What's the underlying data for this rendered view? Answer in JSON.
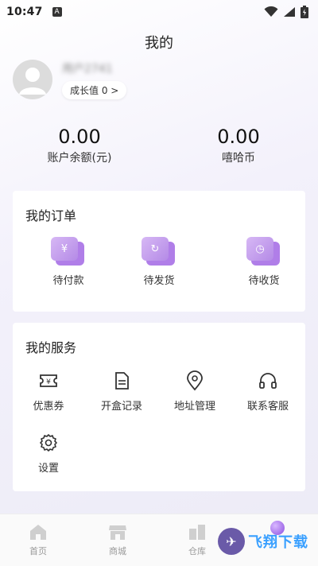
{
  "status_bar": {
    "time": "10:47",
    "notification_letter": "A"
  },
  "page": {
    "title": "我的"
  },
  "profile": {
    "username": "用户2741",
    "growth_label": "成长值 0 >"
  },
  "balances": [
    {
      "amount": "0.00",
      "label": "账户余额(元)"
    },
    {
      "amount": "0.00",
      "label": "嘻哈币"
    }
  ],
  "orders": {
    "title": "我的订单",
    "items": [
      {
        "label": "待付款",
        "glyph": "¥",
        "icon": "wallet-icon"
      },
      {
        "label": "待发货",
        "glyph": "↻",
        "icon": "pending-ship-icon"
      },
      {
        "label": "待收货",
        "glyph": "◷",
        "icon": "receive-icon"
      }
    ]
  },
  "services": {
    "title": "我的服务",
    "items": [
      {
        "label": "优惠券",
        "icon": "coupon-icon"
      },
      {
        "label": "开盒记录",
        "icon": "record-icon"
      },
      {
        "label": "地址管理",
        "icon": "location-icon"
      },
      {
        "label": "联系客服",
        "icon": "headset-icon"
      },
      {
        "label": "设置",
        "icon": "gear-icon"
      }
    ]
  },
  "tabs": [
    {
      "label": "首页",
      "icon": "home-icon"
    },
    {
      "label": "商城",
      "icon": "shop-icon"
    },
    {
      "label": "仓库",
      "icon": "warehouse-icon"
    }
  ],
  "watermark": {
    "text": "飞翔下载"
  },
  "colors": {
    "accent": "#b48ae6",
    "tab_inactive": "#999999",
    "mine_active": "#8c4fe0"
  }
}
